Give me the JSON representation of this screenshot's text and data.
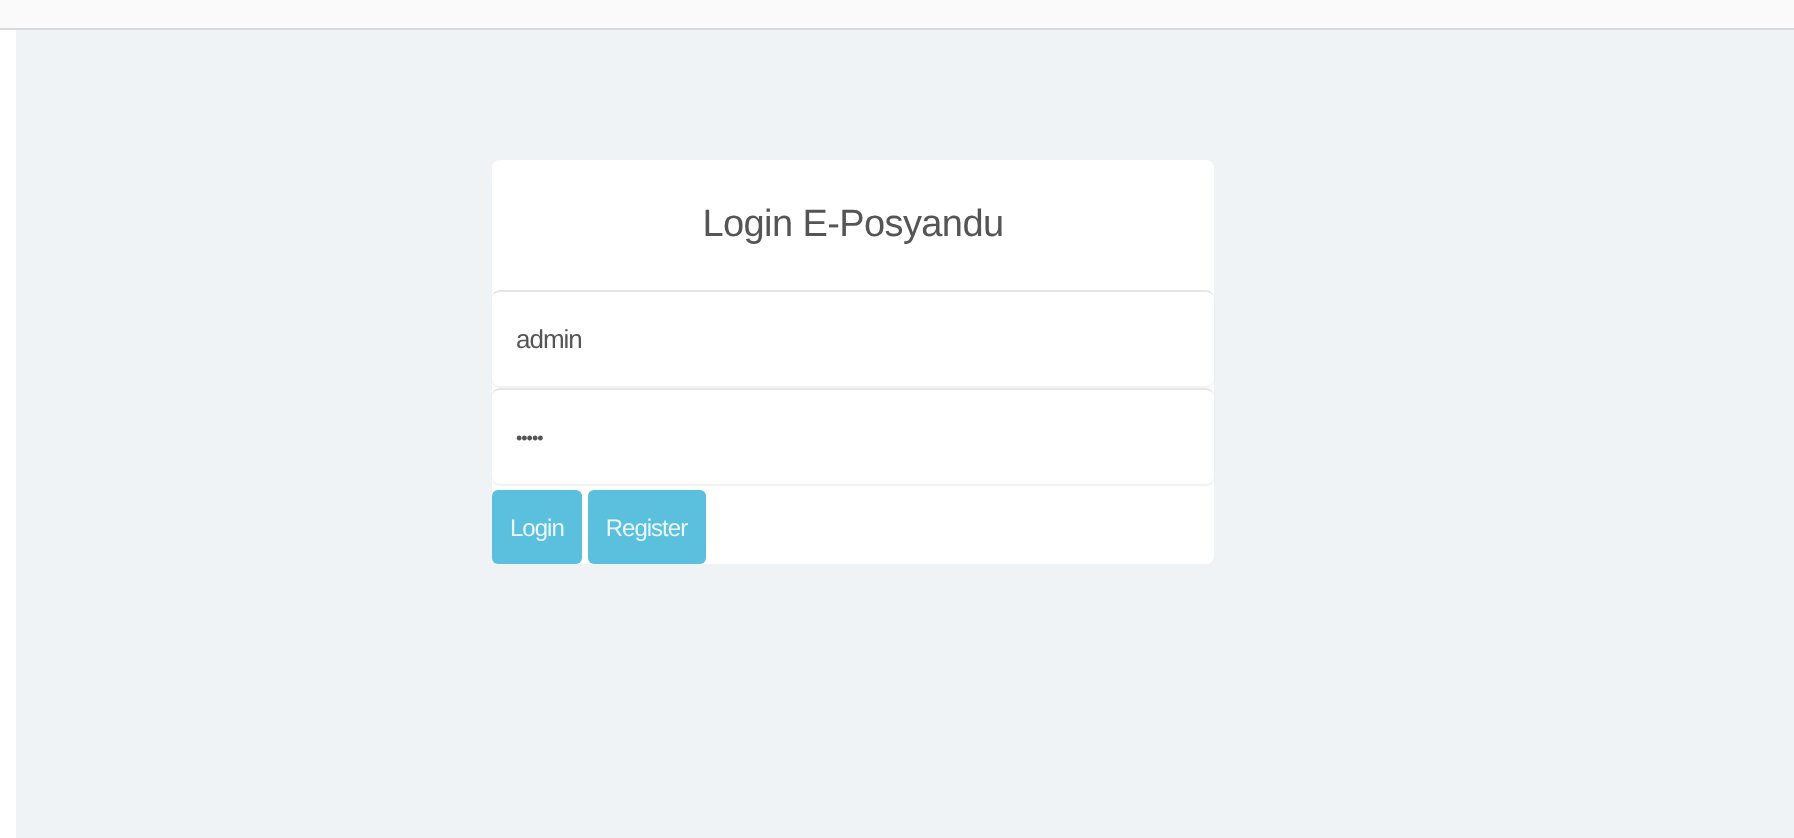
{
  "login_card": {
    "title": "Login E-Posyandu",
    "fields": [
      {
        "kind": "username",
        "value": "admin"
      },
      {
        "kind": "password",
        "value": "•••••"
      }
    ],
    "buttons": [
      {
        "label": "Login"
      },
      {
        "label": "Register"
      }
    ]
  }
}
